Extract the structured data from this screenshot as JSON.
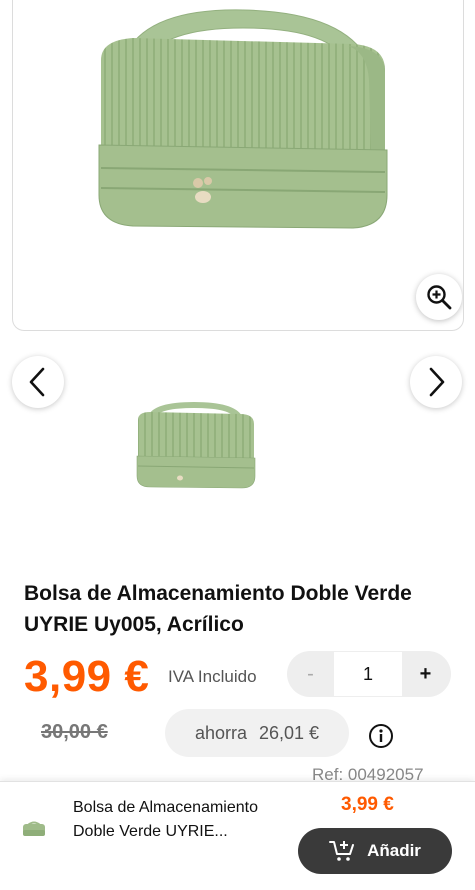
{
  "product": {
    "title": "Bolsa de Almacenamiento Doble Verde UYRIE Uy005, Acrílico",
    "price": "3,99 €",
    "tax_label": "IVA Incluido",
    "old_price": "30,00 €",
    "savings_label": "ahorra",
    "savings_amount": "26,01 €",
    "reference": "Ref: 00492057"
  },
  "quantity": {
    "minus": "-",
    "value": "1",
    "plus": "+"
  },
  "sticky_bar": {
    "title": "Bolsa de Almacenamiento Doble Verde UYRIE...",
    "price": "3,99 €",
    "add_label": "Añadir"
  },
  "icons": {
    "zoom": "zoom-in-icon",
    "prev": "chevron-left-icon",
    "next": "chevron-right-icon",
    "info": "info-icon",
    "cart": "cart-plus-icon"
  },
  "colors": {
    "accent": "#ff5a00",
    "bag_green": "#a8c293",
    "button_dark": "#3a3a3a"
  }
}
